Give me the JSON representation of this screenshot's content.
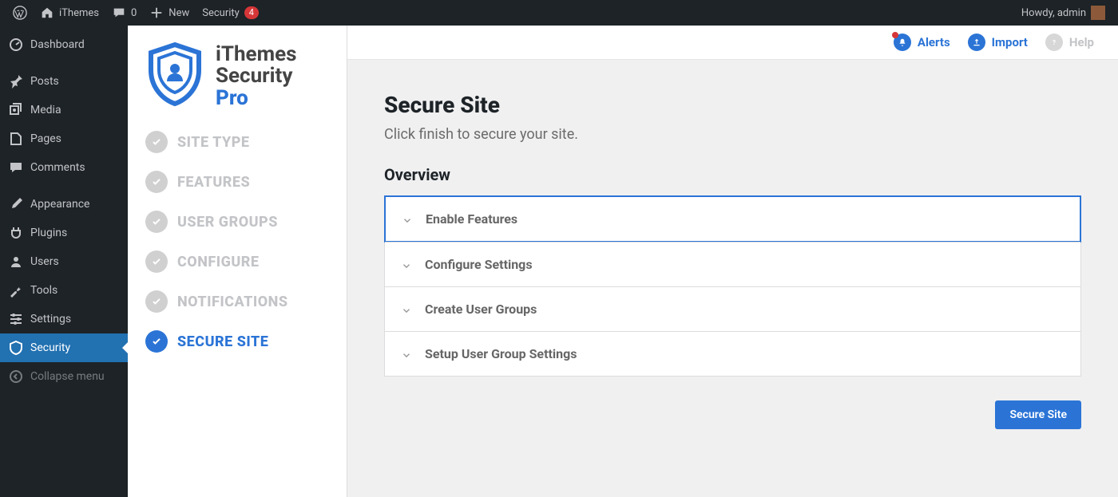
{
  "adminbar": {
    "site_name": "iThemes",
    "comments_count": "0",
    "new_label": "New",
    "security_label": "Security",
    "security_badge": "4",
    "greeting": "Howdy, admin"
  },
  "wp_menu": {
    "dashboard": "Dashboard",
    "posts": "Posts",
    "media": "Media",
    "pages": "Pages",
    "comments": "Comments",
    "appearance": "Appearance",
    "plugins": "Plugins",
    "users": "Users",
    "tools": "Tools",
    "settings": "Settings",
    "security": "Security",
    "collapse": "Collapse menu"
  },
  "logo": {
    "line1": "iThemes",
    "line2": "Security",
    "line3": "Pro"
  },
  "steps": {
    "site_type": "SITE TYPE",
    "features": "FEATURES",
    "user_groups": "USER GROUPS",
    "configure": "CONFIGURE",
    "notifications": "NOTIFICATIONS",
    "secure_site": "SECURE SITE"
  },
  "topbar": {
    "alerts": "Alerts",
    "import": "Import",
    "help": "Help"
  },
  "main": {
    "title": "Secure Site",
    "subtitle": "Click finish to secure your site.",
    "overview": "Overview",
    "accordion": {
      "enable_features": "Enable Features",
      "configure_settings": "Configure Settings",
      "create_user_groups": "Create User Groups",
      "setup_user_group_settings": "Setup User Group Settings"
    },
    "button": "Secure Site"
  }
}
